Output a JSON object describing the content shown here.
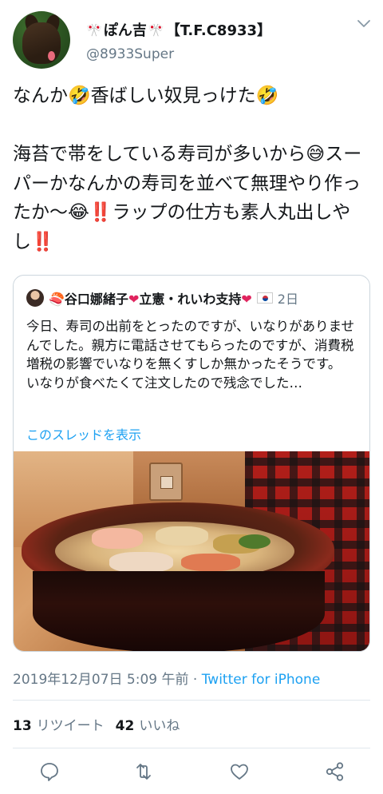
{
  "author": {
    "display_name": "ぽん吉",
    "sparkle": "🎌",
    "team_tag": "【T.F.C8933】",
    "handle": "@8933Super"
  },
  "tweet": {
    "text": "なんか🤣香ばしい奴見っけた🤣\n\n海苔で帯をしている寿司が多いから😅スーパーかなんかの寿司を並べて無理やり作ったか〜😂‼️ラップの仕方も素人丸出しやし‼️"
  },
  "quote": {
    "emoji_prefix": "🍣",
    "name_part1": "谷口娜緒子",
    "heart": "❤",
    "name_part2": "立憲・れいわ支持",
    "flag_label": "🇰🇷",
    "time": "2日",
    "body": "今日、寿司の出前をとったのですが、いなりがありませんでした。親方に電話させてもらったのですが、消費税増税の影響でいなりを無くすしか無かったそうです。\nいなりが食べたくて注文したので残念でした…",
    "show_thread": "このスレッドを表示"
  },
  "meta": {
    "timestamp": "2019年12月07日 5:09 午前",
    "separator": " · ",
    "source": "Twitter for iPhone"
  },
  "stats": {
    "retweets_count": "13",
    "retweets_label": "リツイート",
    "likes_count": "42",
    "likes_label": "いいね"
  },
  "icons": [
    "reply-icon",
    "retweet-icon",
    "like-icon",
    "share-icon",
    "chevron-down-icon"
  ],
  "colors": {
    "link": "#1da1f2",
    "secondary": "#657786",
    "heart": "#e0245e"
  }
}
